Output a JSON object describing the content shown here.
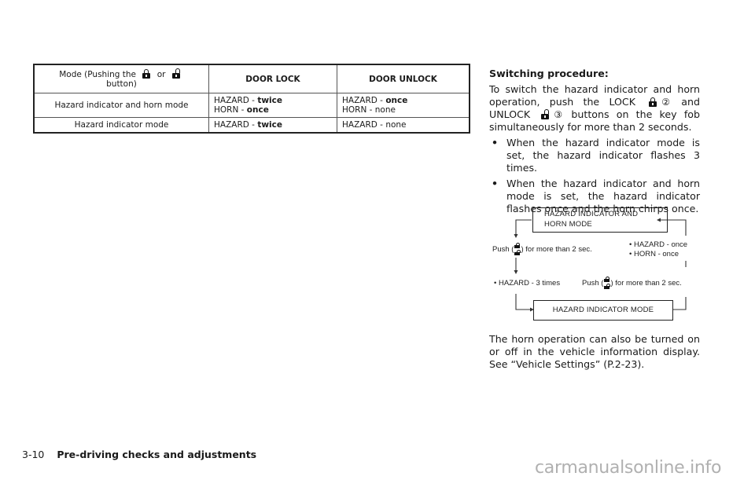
{
  "table": {
    "header": {
      "mode_prefix": "Mode (Pushing the",
      "mode_or": "or",
      "mode_suffix": "button)",
      "lock_icon": "lock-icon",
      "unlock_icon": "unlock-icon",
      "door_lock": "DOOR LOCK",
      "door_unlock": "DOOR UNLOCK"
    },
    "rows": [
      {
        "mode": "Hazard indicator and horn mode",
        "door_lock": [
          {
            "label": "HAZARD - ",
            "value": "twice",
            "bold": true
          },
          {
            "label": "HORN - ",
            "value": "once",
            "bold": true
          }
        ],
        "door_unlock": [
          {
            "label": "HAZARD - ",
            "value": "once",
            "bold": true
          },
          {
            "label": "HORN - ",
            "value": "none",
            "bold": false
          }
        ]
      },
      {
        "mode": "Hazard indicator mode",
        "door_lock": [
          {
            "label": "HAZARD - ",
            "value": "twice",
            "bold": true
          }
        ],
        "door_unlock": [
          {
            "label": "HAZARD - ",
            "value": "none",
            "bold": false
          }
        ]
      }
    ]
  },
  "procedure": {
    "heading": "Switching procedure:",
    "intro_1": "To switch the hazard indicator and horn operation, push the LOCK",
    "lock_ref": "②",
    "intro_2": "and UNLOCK",
    "unlock_ref": "③",
    "intro_3": "buttons on the key fob simultaneously for more than 2 seconds.",
    "bullets": [
      "When the hazard indicator mode is set, the hazard indicator flashes 3 times.",
      "When the hazard indicator and horn mode is set, the hazard indicator flashes once and the horn chirps once."
    ],
    "bullet_glyph": "•",
    "closing": "The horn operation can also be turned on or off in the vehicle information display. See “Vehicle Settings” (P.2-23)."
  },
  "diagram": {
    "top_box": [
      "HAZARD INDICATOR AND",
      "HORN MODE"
    ],
    "bottom_box": "HAZARD INDICATOR MODE",
    "left_push_prefix": "Push (",
    "left_push_suffix": ") for more than 2 sec.",
    "right_push_prefix": "Push (",
    "right_push_suffix": ") for more than 2 sec.",
    "right_notes": [
      "• HAZARD - once",
      "• HORN - once"
    ],
    "left_note": "• HAZARD - 3 times"
  },
  "footer": {
    "page_number": "3-10",
    "section_title": "Pre-driving checks and adjustments"
  },
  "watermark": "carmanualsonline.info"
}
